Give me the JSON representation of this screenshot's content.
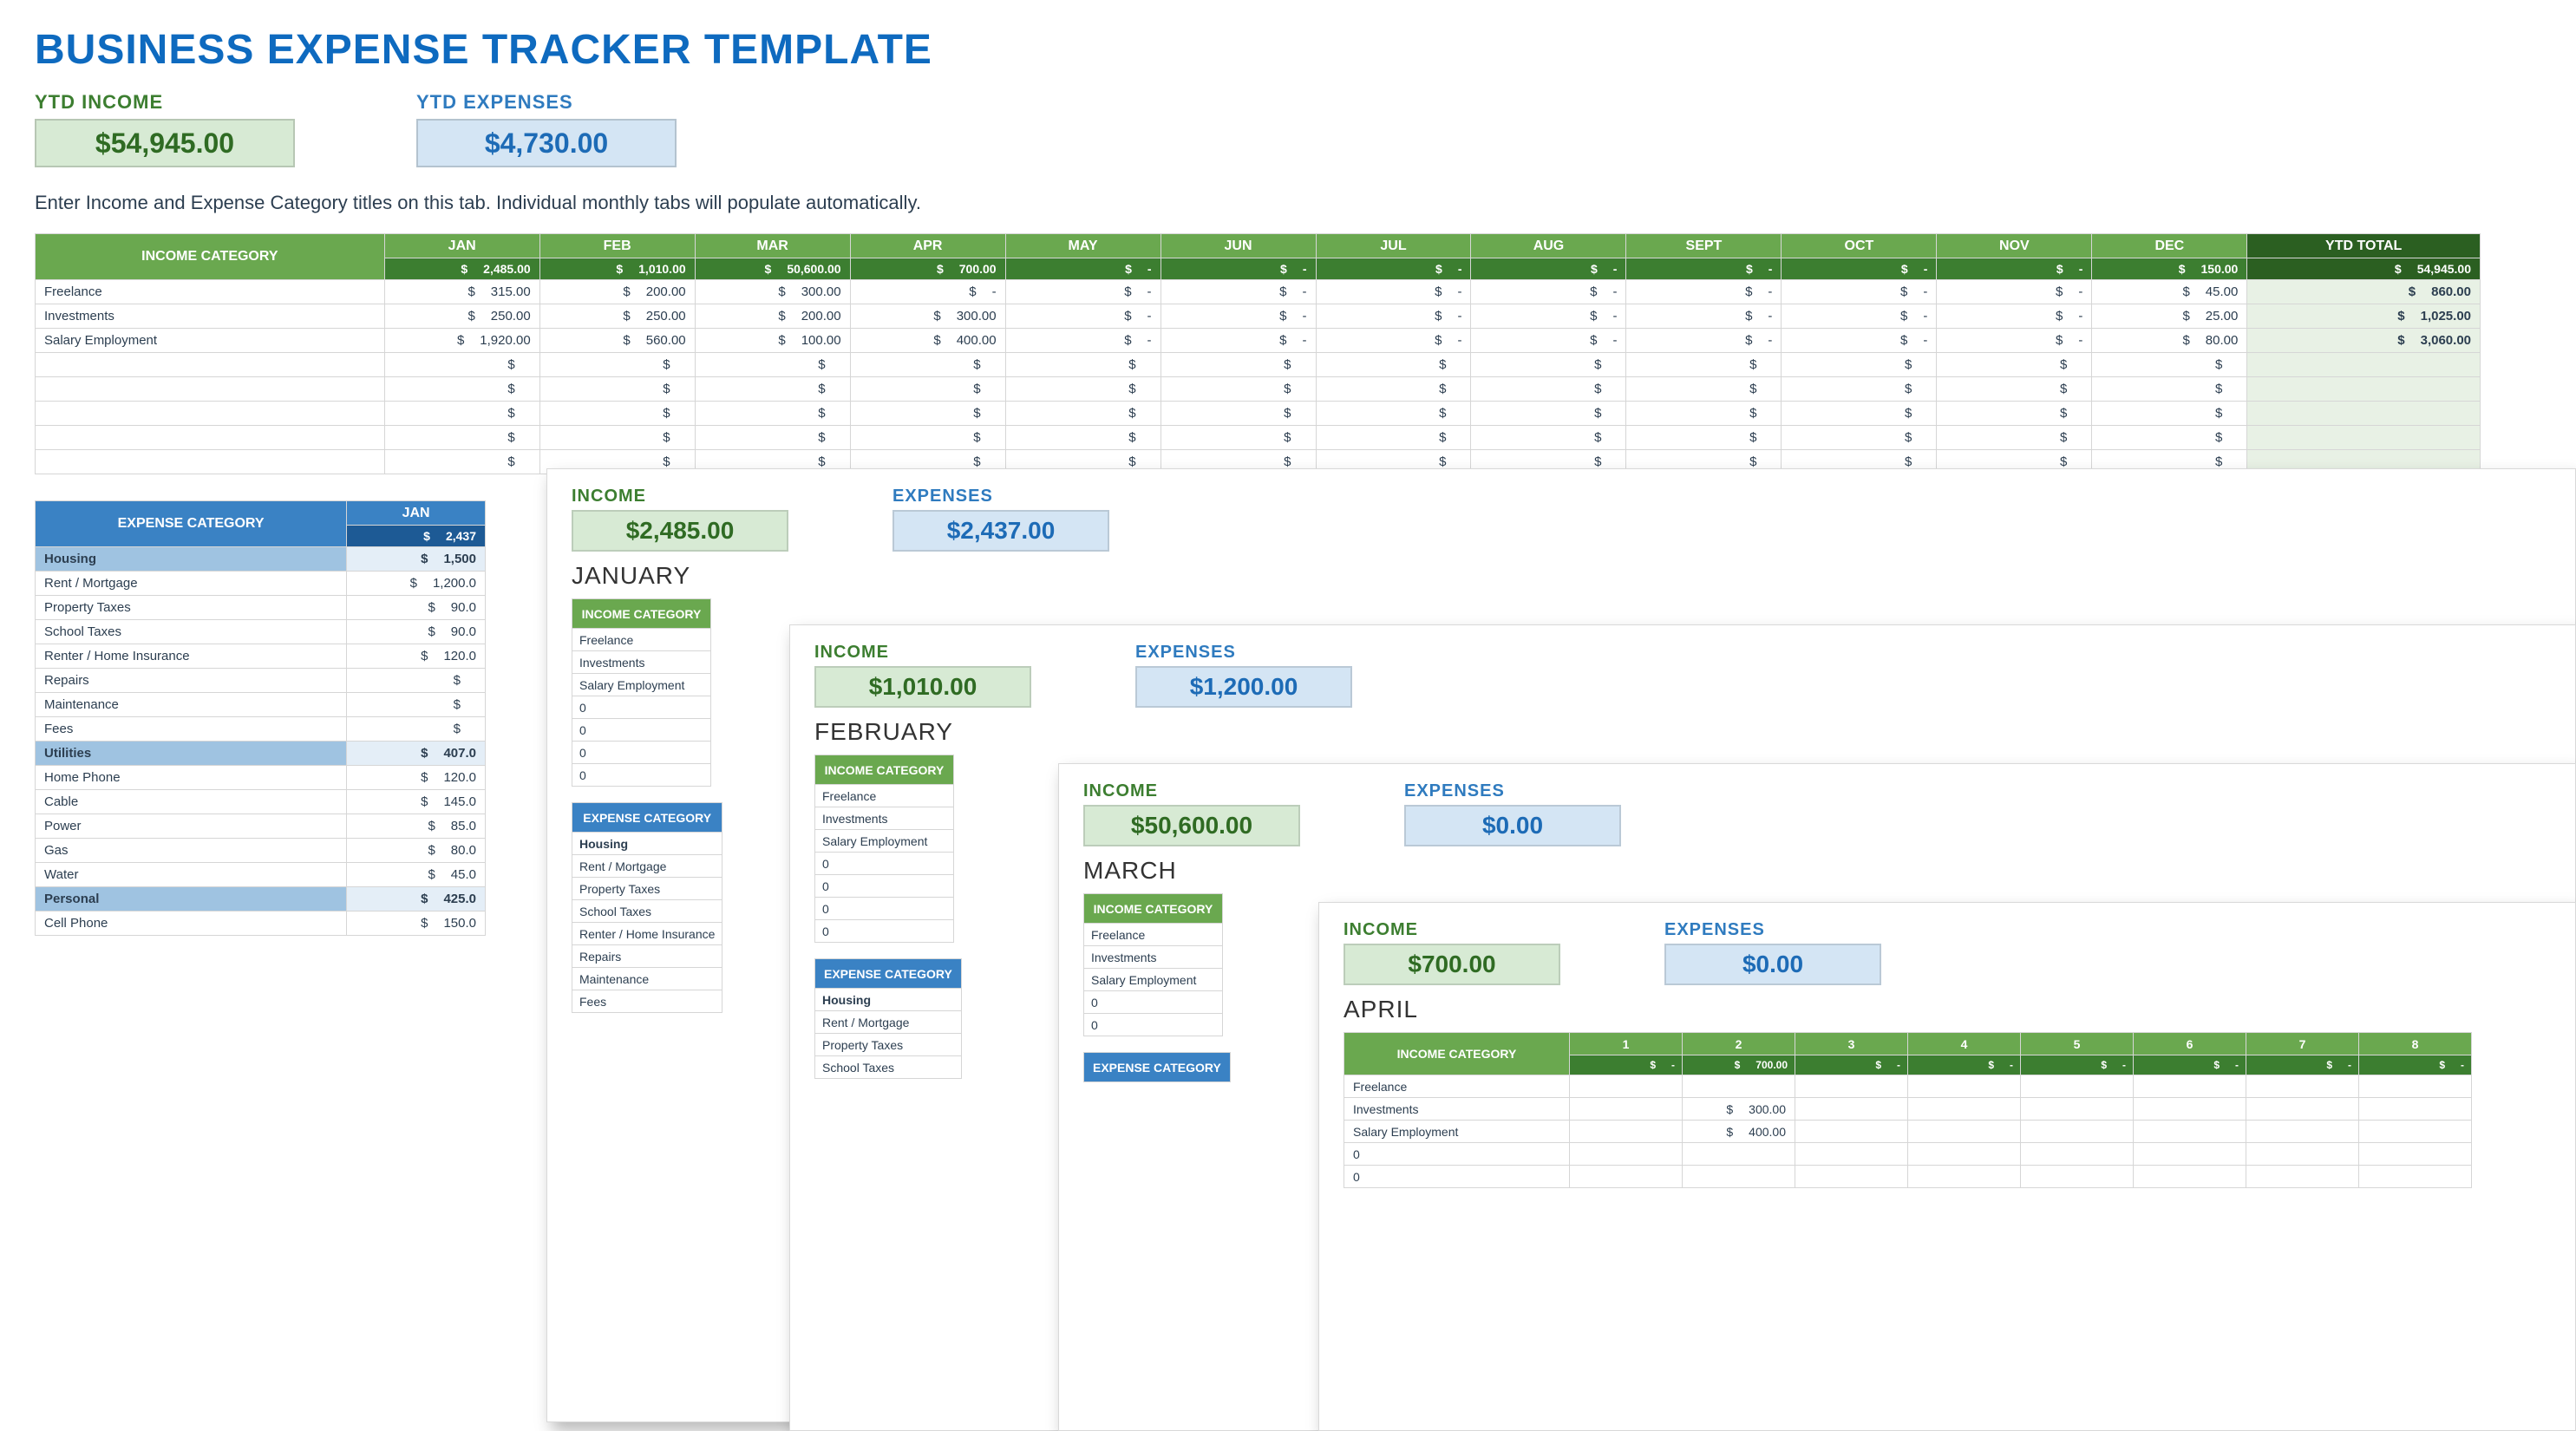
{
  "title": "BUSINESS EXPENSE TRACKER TEMPLATE",
  "kpi": {
    "income_label": "YTD INCOME",
    "income_value": "$54,945.00",
    "expense_label": "YTD EXPENSES",
    "expense_value": "$4,730.00"
  },
  "instructions": "Enter Income and Expense Category titles on this tab.  Individual monthly tabs will populate automatically.",
  "months": [
    "JAN",
    "FEB",
    "MAR",
    "APR",
    "MAY",
    "JUN",
    "JUL",
    "AUG",
    "SEPT",
    "OCT",
    "NOV",
    "DEC"
  ],
  "ytd_label": "YTD TOTAL",
  "income_category_label": "INCOME CATEGORY",
  "expense_category_label": "EXPENSE CATEGORY",
  "income_month_totals": [
    "2,485.00",
    "1,010.00",
    "50,600.00",
    "700.00",
    "-",
    "-",
    "-",
    "-",
    "-",
    "-",
    "-",
    "150.00"
  ],
  "income_ytd_total": "54,945.00",
  "income_rows": [
    {
      "name": "Freelance",
      "cells": [
        "315.00",
        "200.00",
        "300.00",
        "-",
        "-",
        "-",
        "-",
        "-",
        "-",
        "-",
        "-",
        "45.00"
      ],
      "ytd": "860.00"
    },
    {
      "name": "Investments",
      "cells": [
        "250.00",
        "250.00",
        "200.00",
        "300.00",
        "-",
        "-",
        "-",
        "-",
        "-",
        "-",
        "-",
        "25.00"
      ],
      "ytd": "1,025.00"
    },
    {
      "name": "Salary Employment",
      "cells": [
        "1,920.00",
        "560.00",
        "100.00",
        "400.00",
        "-",
        "-",
        "-",
        "-",
        "-",
        "-",
        "-",
        "80.00"
      ],
      "ytd": "3,060.00"
    }
  ],
  "expense_jan_total": "2,437",
  "expense_groups": [
    {
      "name": "Housing",
      "total": "1,500",
      "items": [
        {
          "name": "Rent / Mortgage",
          "val": "1,200.0"
        },
        {
          "name": "Property Taxes",
          "val": "90.0"
        },
        {
          "name": "School Taxes",
          "val": "90.0"
        },
        {
          "name": "Renter / Home Insurance",
          "val": "120.0"
        },
        {
          "name": "Repairs",
          "val": ""
        },
        {
          "name": "Maintenance",
          "val": ""
        },
        {
          "name": "Fees",
          "val": ""
        }
      ]
    },
    {
      "name": "Utilities",
      "total": "407.0",
      "items": [
        {
          "name": "Home Phone",
          "val": "120.0"
        },
        {
          "name": "Cable",
          "val": "145.0"
        },
        {
          "name": "Power",
          "val": "85.0"
        },
        {
          "name": "Gas",
          "val": "80.0"
        },
        {
          "name": "Water",
          "val": "45.0"
        }
      ]
    },
    {
      "name": "Personal",
      "total": "425.0",
      "items": [
        {
          "name": "Cell Phone",
          "val": "150.0"
        }
      ]
    }
  ],
  "cards": {
    "jan": {
      "income_label": "INCOME",
      "income_value": "$2,485.00",
      "expense_label": "EXPENSES",
      "expense_value": "$2,437.00",
      "month": "JANUARY",
      "income_header": "INCOME CATEGORY",
      "income_list": [
        "Freelance",
        "Investments",
        "Salary Employment",
        "0",
        "0",
        "0",
        "0"
      ],
      "expense_header": "EXPENSE CATEGORY",
      "expense_group": "Housing",
      "expense_list": [
        "Rent / Mortgage",
        "Property Taxes",
        "School Taxes",
        "Renter / Home Insurance",
        "Repairs",
        "Maintenance",
        "Fees"
      ]
    },
    "feb": {
      "income_label": "INCOME",
      "income_value": "$1,010.00",
      "expense_label": "EXPENSES",
      "expense_value": "$1,200.00",
      "month": "FEBRUARY",
      "income_header": "INCOME CATEGORY",
      "income_list": [
        "Freelance",
        "Investments",
        "Salary Employment",
        "0",
        "0",
        "0",
        "0"
      ],
      "expense_header": "EXPENSE CATEGORY",
      "expense_group": "Housing",
      "expense_list": [
        "Rent / Mortgage",
        "Property Taxes",
        "School Taxes"
      ]
    },
    "mar": {
      "income_label": "INCOME",
      "income_value": "$50,600.00",
      "expense_label": "EXPENSES",
      "expense_value": "$0.00",
      "month": "MARCH",
      "income_header": "INCOME CATEGORY",
      "income_list": [
        "Freelance",
        "Investments",
        "Salary Employment",
        "0",
        "0"
      ],
      "expense_header": "EXPENSE CATEGORY"
    },
    "apr": {
      "income_label": "INCOME",
      "income_value": "$700.00",
      "expense_label": "EXPENSES",
      "expense_value": "$0.00",
      "month": "APRIL",
      "income_header": "INCOME CATEGORY",
      "days": [
        "1",
        "2",
        "3",
        "4",
        "5",
        "6",
        "7",
        "8"
      ],
      "day_totals": [
        "-",
        "700.00",
        "-",
        "-",
        "-",
        "-",
        "-",
        "-"
      ],
      "rows": [
        {
          "name": "Freelance",
          "cells": [
            "",
            "",
            "",
            "",
            "",
            "",
            "",
            ""
          ]
        },
        {
          "name": "Investments",
          "cells": [
            "",
            "300.00",
            "",
            "",
            "",
            "",
            "",
            ""
          ]
        },
        {
          "name": "Salary Employment",
          "cells": [
            "",
            "400.00",
            "",
            "",
            "",
            "",
            "",
            ""
          ]
        },
        {
          "name": "0",
          "cells": [
            "",
            "",
            "",
            "",
            "",
            "",
            "",
            ""
          ]
        },
        {
          "name": "0",
          "cells": [
            "",
            "",
            "",
            "",
            "",
            "",
            "",
            ""
          ]
        }
      ]
    }
  }
}
